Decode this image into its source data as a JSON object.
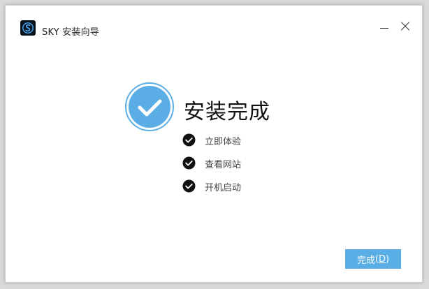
{
  "window": {
    "title": "SKY 安装向导",
    "logo_icon": "app-logo-icon"
  },
  "main": {
    "headline": "安装完成",
    "options": [
      {
        "label": "立即体验",
        "checked": true
      },
      {
        "label": "查看网站",
        "checked": true
      },
      {
        "label": "开机启动",
        "checked": true
      }
    ]
  },
  "footer": {
    "finish_label": "完成",
    "finish_shortcut_text": "(D)",
    "finish_shortcut_key": "D"
  },
  "colors": {
    "accent": "#59aee6",
    "check_circle_outer": "#5aaee5",
    "check_badge": "#111111"
  }
}
